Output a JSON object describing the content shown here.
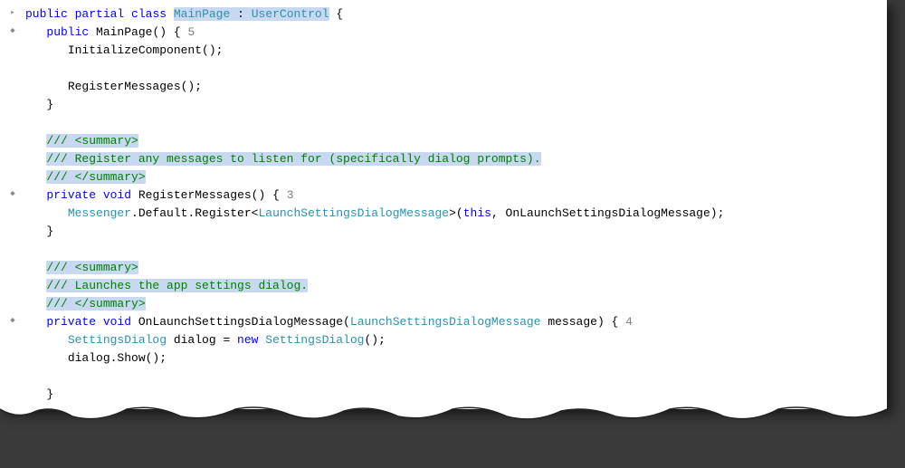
{
  "code": {
    "line1": {
      "kw1": "public",
      "kw2": "partial",
      "kw3": "class",
      "type1": "MainPage",
      "colon": " : ",
      "type2": "UserControl",
      "brace": " {"
    },
    "line2": {
      "indent": "   ",
      "kw": "public",
      "space": " ",
      "name": "MainPage",
      "rest": "() { ",
      "ref": "5"
    },
    "line3": {
      "indent": "      ",
      "text": "InitializeComponent();"
    },
    "line4": {
      "text": ""
    },
    "line5": {
      "indent": "      ",
      "text": "RegisterMessages();"
    },
    "line6": {
      "indent": "   ",
      "brace": "}"
    },
    "line7": {
      "text": ""
    },
    "line8": {
      "indent": "   ",
      "doc": "/// <summary>"
    },
    "line9": {
      "indent": "   ",
      "doc": "/// Register any messages to listen for (specifically dialog prompts)."
    },
    "line10": {
      "indent": "   ",
      "doc": "/// </summary>"
    },
    "line11": {
      "indent": "   ",
      "kw1": "private",
      "kw2": "void",
      "name": " RegisterMessages() { ",
      "ref": "3"
    },
    "line12": {
      "indent": "      ",
      "type1": "Messenger",
      "mid": ".Default.Register<",
      "type2": "LaunchSettingsDialogMessage",
      "mid2": ">(",
      "kw": "this",
      "rest": ", OnLaunchSettingsDialogMessage);"
    },
    "line13": {
      "indent": "   ",
      "brace": "}"
    },
    "line14": {
      "text": ""
    },
    "line15": {
      "indent": "   ",
      "doc": "/// <summary>"
    },
    "line16": {
      "indent": "   ",
      "doc": "/// Launches the app settings dialog."
    },
    "line17": {
      "indent": "   ",
      "doc": "/// </summary>"
    },
    "line18": {
      "indent": "   ",
      "kw1": "private",
      "kw2": "void",
      "name1": " OnLaunchSettingsDialogMessage(",
      "type": "LaunchSettingsDialogMessage",
      "name2": " message) { ",
      "ref": "4"
    },
    "line19": {
      "indent": "      ",
      "type1": "SettingsDialog",
      "mid1": " dialog = ",
      "kw": "new",
      "space": " ",
      "type2": "SettingsDialog",
      "rest": "();"
    },
    "line20": {
      "indent": "      ",
      "text": "dialog.Show();"
    },
    "line21": {
      "text": ""
    },
    "line22": {
      "indent": "   ",
      "brace": "}"
    }
  }
}
